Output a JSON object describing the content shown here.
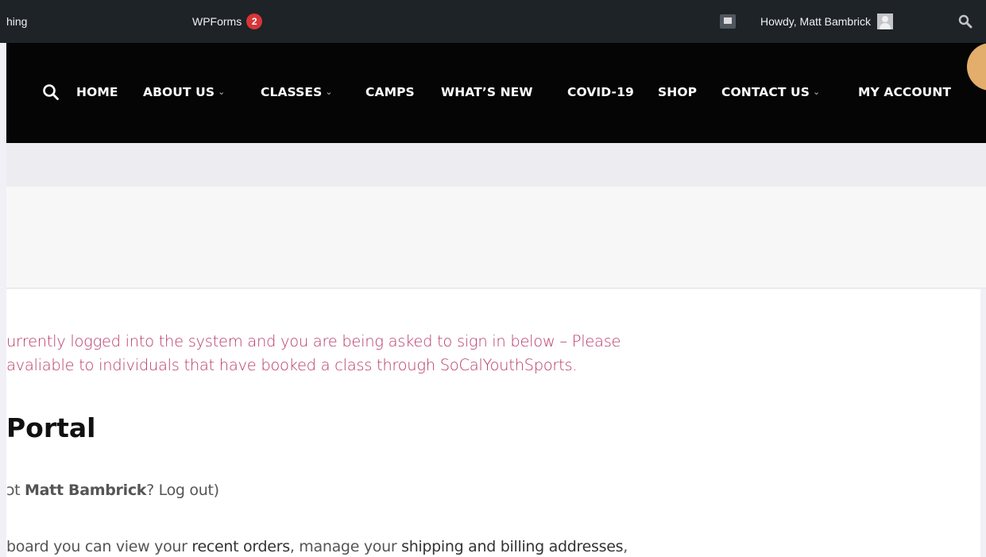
{
  "admin_bar": {
    "partial_item": "hing",
    "wpforms_label": "WPForms",
    "wpforms_count": "2",
    "howdy": "Howdy, Matt Bambrick"
  },
  "nav": {
    "items": [
      {
        "label": "HOME",
        "has_dropdown": false
      },
      {
        "label": "ABOUT US",
        "has_dropdown": true
      },
      {
        "label": "CLASSES",
        "has_dropdown": true
      },
      {
        "label": "CAMPS",
        "has_dropdown": false
      },
      {
        "label": "WHAT’S NEW",
        "has_dropdown": false
      },
      {
        "label": "COVID-19",
        "has_dropdown": false
      },
      {
        "label": "SHOP",
        "has_dropdown": false
      },
      {
        "label": "CONTACT US",
        "has_dropdown": true
      },
      {
        "label": "MY ACCOUNT",
        "has_dropdown": false
      }
    ],
    "chevron": "⌄"
  },
  "notice": {
    "line1": "urrently logged into the system and you are being asked to sign in below – Please",
    "line2": "avaliable to individuals that have booked a class through SoCalYouthSports."
  },
  "portal": {
    "title": "Portal",
    "hello_prefix": "ɔt ",
    "hello_name": "Matt Bambrick",
    "hello_mid": "? ",
    "hello_logout": "Log out",
    "hello_suffix": ")",
    "dash_prefix": "board you can view your ",
    "dash_recent_orders": "recent orders",
    "dash_mid": ", manage your ",
    "dash_addresses": "shipping and billing addresses",
    "dash_suffix": ","
  },
  "colors": {
    "admin_bar_bg": "#1d2327",
    "nav_bg": "#050505",
    "notice_text": "#b83a6a",
    "badge": "#d63638",
    "accent_circle": "#e3ad6b"
  }
}
